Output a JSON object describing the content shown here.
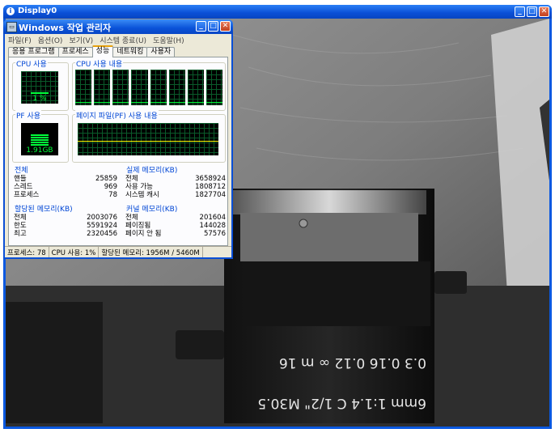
{
  "outer_window": {
    "title": "Display0"
  },
  "task_manager": {
    "title": "Windows 작업 관리자",
    "menu": [
      "파일(F)",
      "옵션(O)",
      "보기(V)",
      "시스템 종료(U)",
      "도움말(H)"
    ],
    "tabs": [
      "응용 프로그램",
      "프로세스",
      "성능",
      "네트워킹",
      "사용자"
    ],
    "active_tab": "성능",
    "cpu_usage": {
      "label": "CPU 사용",
      "value": "1 %",
      "percent": 1
    },
    "cpu_history": {
      "label": "CPU 사용 내용",
      "cores": 8
    },
    "pf_usage": {
      "label": "PF 사용",
      "value": "1.91GB"
    },
    "pf_history": {
      "label": "페이지 파일(PF) 사용 내용"
    },
    "totals": {
      "label": "전체",
      "rows": [
        {
          "name": "핸들",
          "value": "25859"
        },
        {
          "name": "스레드",
          "value": "969"
        },
        {
          "name": "프로세스",
          "value": "78"
        }
      ]
    },
    "physical": {
      "label": "실제 메모리(KB)",
      "rows": [
        {
          "name": "전체",
          "value": "3658924"
        },
        {
          "name": "사용 가능",
          "value": "1808712"
        },
        {
          "name": "시스템 캐시",
          "value": "1827704"
        }
      ]
    },
    "commit": {
      "label": "할당된 메모리(KB)",
      "rows": [
        {
          "name": "전체",
          "value": "2003076"
        },
        {
          "name": "한도",
          "value": "5591924"
        },
        {
          "name": "최고",
          "value": "2320456"
        }
      ]
    },
    "kernel": {
      "label": "커널 메모리(KB)",
      "rows": [
        {
          "name": "전체",
          "value": "201604"
        },
        {
          "name": "페이징됨",
          "value": "144028"
        },
        {
          "name": "페이지 안 됨",
          "value": "57576"
        }
      ]
    },
    "status_bar": {
      "processes": "프로세스: 78",
      "cpu": "CPU 사용: 1%",
      "memory": "할당된 메모리: 1956M / 5460M"
    }
  },
  "lens": {
    "text": "6mm 1:1.4 C 1/2\" M30.5",
    "scale": "0.3   0.16   0.12   ∞   m   16"
  },
  "colors": {
    "xp_blue": "#0a4fd6",
    "graph_green": "#00ff3a",
    "dialog_bg": "#ece9d8"
  }
}
